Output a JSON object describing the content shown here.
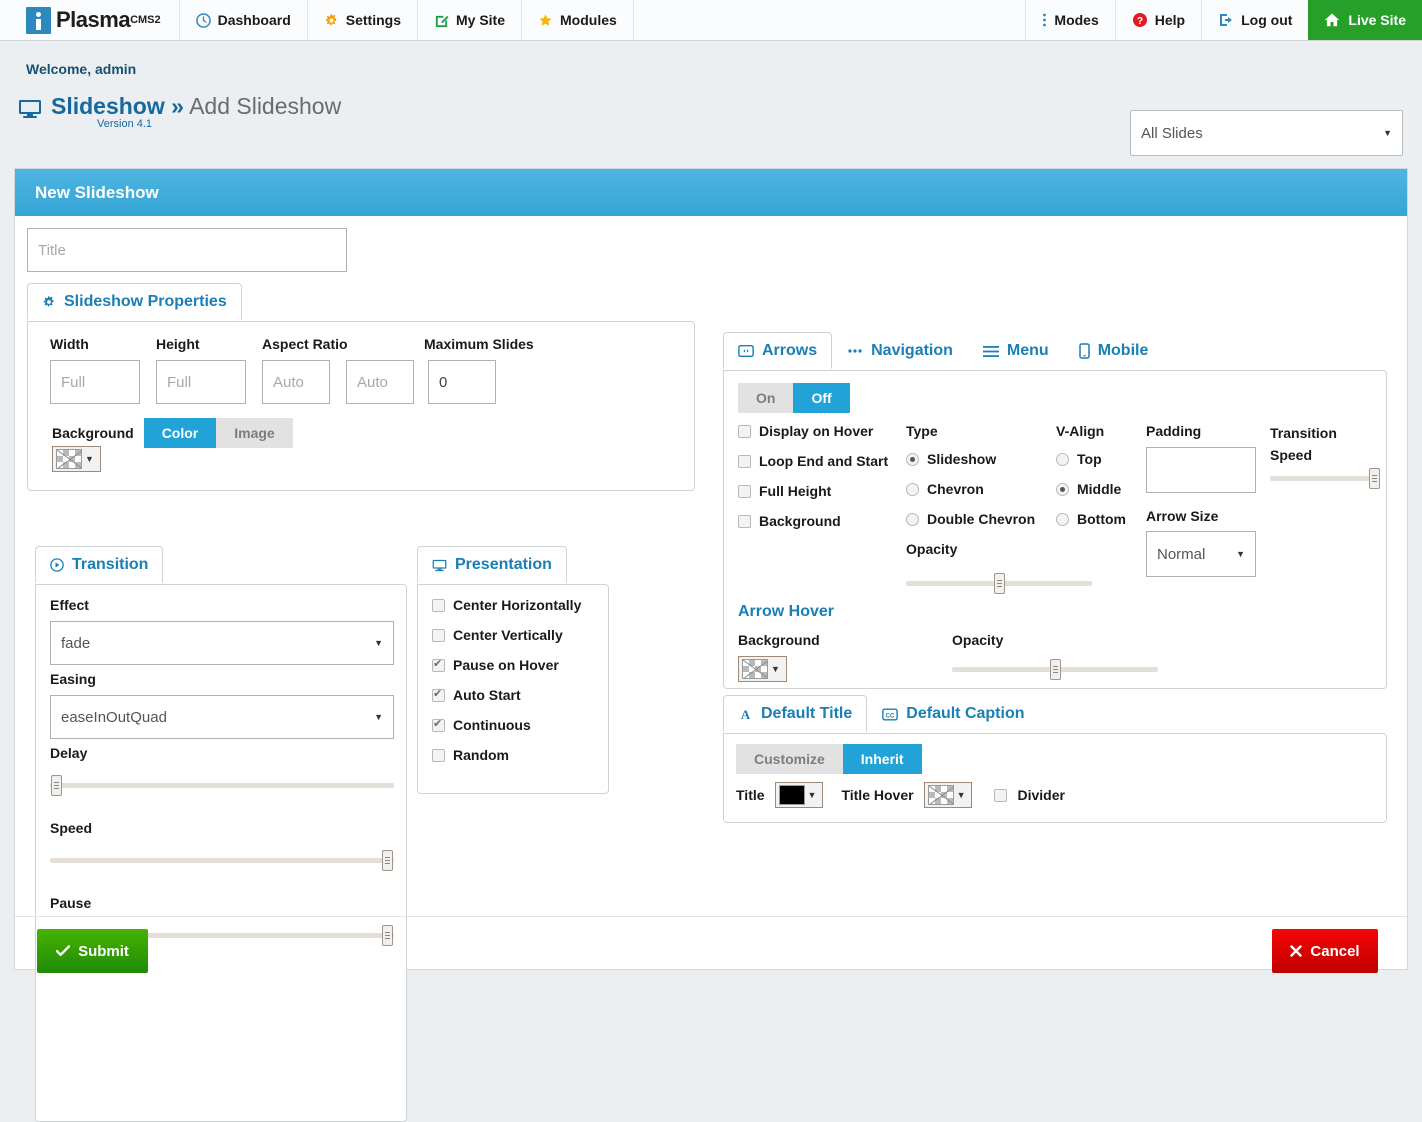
{
  "topnav": {
    "brand": {
      "name": "Plasma",
      "suffix": "CMS2"
    },
    "left_items": [
      {
        "label": "Dashboard",
        "icon": "clock-icon"
      },
      {
        "label": "Settings",
        "icon": "gear-icon"
      },
      {
        "label": "My Site",
        "icon": "edit-square-icon"
      },
      {
        "label": "Modules",
        "icon": "star-icon"
      }
    ],
    "right_items": [
      {
        "label": "Modes",
        "icon": "vertical-dots-icon"
      },
      {
        "label": "Help",
        "icon": "question-circle-icon"
      },
      {
        "label": "Log out",
        "icon": "logout-icon"
      }
    ],
    "live_site": {
      "label": "Live Site",
      "icon": "home-icon"
    }
  },
  "header": {
    "welcome": "Welcome, admin",
    "module": "Slideshow",
    "separator": "»",
    "page": "Add Slideshow",
    "version": "Version 4.1",
    "slides_filter": "All Slides"
  },
  "panel": {
    "title": "New Slideshow",
    "title_input": {
      "value": "",
      "placeholder": "Title"
    }
  },
  "properties": {
    "tab_label": "Slideshow Properties",
    "tab_icon": "gear-icon",
    "fields": [
      {
        "label": "Width",
        "value": "",
        "placeholder": "Full"
      },
      {
        "label": "Height",
        "value": "",
        "placeholder": "Full"
      },
      {
        "label": "Aspect Ratio",
        "value": "",
        "placeholder": "Auto"
      },
      {
        "label": "",
        "value": "",
        "placeholder": "Auto"
      },
      {
        "label": "Maximum Slides",
        "value": "0",
        "placeholder": ""
      }
    ],
    "background_label": "Background",
    "background_modes": [
      {
        "label": "Color",
        "selected": true
      },
      {
        "label": "Image",
        "selected": false
      }
    ],
    "background_swatch": "transparent"
  },
  "transition": {
    "tab_label": "Transition",
    "tab_icon": "play-circle-icon",
    "effect_label": "Effect",
    "effect_value": "fade",
    "easing_label": "Easing",
    "easing_value": "easeInOutQuad",
    "delay_label": "Delay",
    "delay_pct": 1,
    "speed_label": "Speed",
    "speed_pct": 98,
    "pause_label": "Pause",
    "pause_pct": 98
  },
  "presentation": {
    "tab_label": "Presentation",
    "tab_icon": "monitor-icon",
    "options": [
      {
        "label": "Center Horizontally",
        "checked": false
      },
      {
        "label": "Center Vertically",
        "checked": false
      },
      {
        "label": "Pause on Hover",
        "checked": true
      },
      {
        "label": "Auto Start",
        "checked": true
      },
      {
        "label": "Continuous",
        "checked": true
      },
      {
        "label": "Random",
        "checked": false
      }
    ]
  },
  "arrows": {
    "tabs": [
      {
        "label": "Arrows",
        "icon": "arrows-box-icon",
        "active": true
      },
      {
        "label": "Navigation",
        "icon": "dots-icon",
        "active": false
      },
      {
        "label": "Menu",
        "icon": "hamburger-icon",
        "active": false
      },
      {
        "label": "Mobile",
        "icon": "mobile-icon",
        "active": false
      }
    ],
    "toggle": [
      {
        "label": "On",
        "selected": false
      },
      {
        "label": "Off",
        "selected": true
      }
    ],
    "checkboxes": [
      {
        "label": "Display on Hover",
        "checked": false
      },
      {
        "label": "Loop End and Start",
        "checked": false
      },
      {
        "label": "Full Height",
        "checked": false
      },
      {
        "label": "Background",
        "checked": false
      }
    ],
    "type_label": "Type",
    "type_options": [
      {
        "label": "Slideshow",
        "selected": true
      },
      {
        "label": "Chevron",
        "selected": false
      },
      {
        "label": "Double Chevron",
        "selected": false
      }
    ],
    "opacity_label": "Opacity",
    "opacity_pct": 50,
    "valign_label": "V-Align",
    "valign_options": [
      {
        "label": "Top",
        "selected": false
      },
      {
        "label": "Middle",
        "selected": true
      },
      {
        "label": "Bottom",
        "selected": false
      }
    ],
    "padding_label": "Padding",
    "padding_value": "",
    "arrow_size_label": "Arrow Size",
    "arrow_size_value": "Normal",
    "transition_speed_label": "Transition Speed",
    "transition_speed_pct": 97,
    "hover_title": "Arrow Hover",
    "hover_background_label": "Background",
    "hover_background_swatch": "transparent",
    "hover_opacity_label": "Opacity",
    "hover_opacity_pct": 50
  },
  "default_title": {
    "tabs": [
      {
        "label": "Default Title",
        "icon": "font-a-icon",
        "active": true
      },
      {
        "label": "Default Caption",
        "icon": "caption-cc-icon",
        "active": false
      }
    ],
    "modes": [
      {
        "label": "Customize",
        "selected": false
      },
      {
        "label": "Inherit",
        "selected": true
      }
    ],
    "title_label": "Title",
    "title_swatch": "#000000",
    "title_hover_label": "Title Hover",
    "title_hover_swatch": "transparent",
    "divider_label": "Divider",
    "divider_checked": false
  },
  "footer": {
    "submit_label": "Submit",
    "submit_icon": "check-icon",
    "cancel_label": "Cancel",
    "cancel_icon": "x-icon"
  },
  "colors": {
    "brand_blue": "#2c89bd",
    "panel_header": "#34a5d6",
    "accent": "#22a3d8",
    "link": "#1a7fb5",
    "green": "#27a02a",
    "red": "#d40000"
  }
}
